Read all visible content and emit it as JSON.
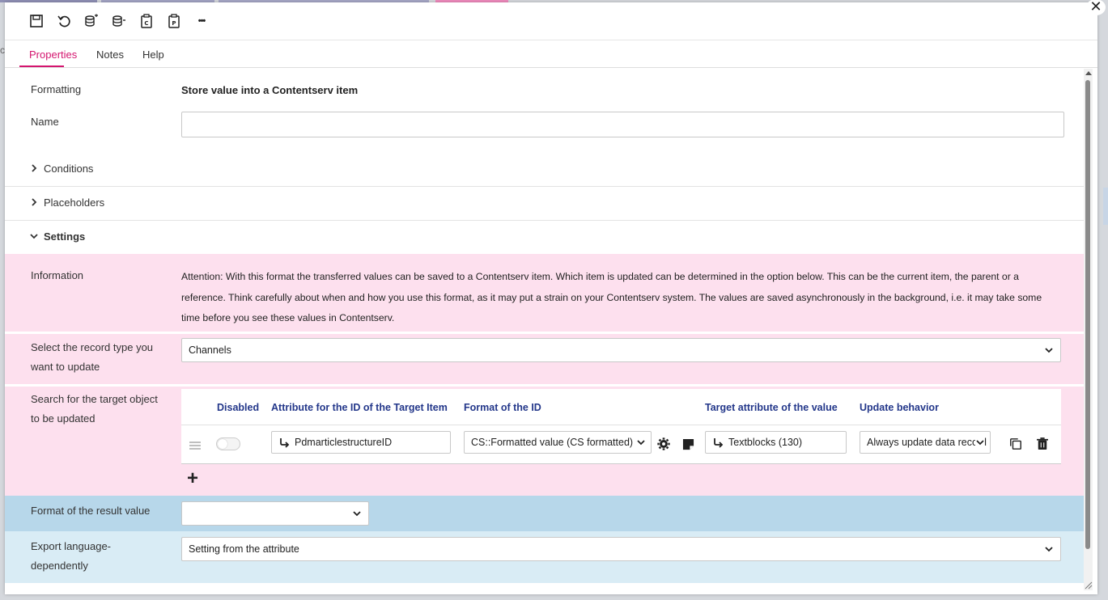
{
  "background": {
    "left_cut_text": "c",
    "tab_colors": [
      "#8f90b5",
      "#a3a4c4",
      "#a6a7c6",
      "#f08abd"
    ]
  },
  "dialog": {
    "close_symbol": "✕"
  },
  "toolbar": {
    "icons": [
      "save-icon",
      "undo-icon",
      "database-export-icon",
      "database-import-icon",
      "clipboard-copy-icon",
      "clipboard-paste-icon",
      "more-icon"
    ],
    "more_label": "•••"
  },
  "tabs": {
    "properties": "Properties",
    "notes": "Notes",
    "help": "Help"
  },
  "form": {
    "formatting_label": "Formatting",
    "formatting_value": "Store value into a Contentserv item",
    "name_label": "Name",
    "name_value": ""
  },
  "sections": {
    "conditions": "Conditions",
    "placeholders": "Placeholders",
    "settings": "Settings"
  },
  "settings": {
    "information_label": "Information",
    "information_text": "Attention: With this format the transferred values can be saved to a Contentserv item. Which item is updated can be determined in the option below. This can be the current item, the parent or a reference. Think carefully about when and how you use this format, as it may put a strain on your Contentserv system. The values are saved asynchronously in the background, i.e. it may take some time before you see these values in Contentserv.",
    "record_type_label": "Select the record type you want to update",
    "record_type_value": "Channels",
    "search_label": "Search for the target object to be updated",
    "grid": {
      "headers": {
        "disabled": "Disabled",
        "attribute_id": "Attribute for the ID of the Target Item",
        "format_id": "Format of the ID",
        "target_attr": "Target attribute of the value",
        "update_behavior": "Update behavior"
      },
      "row": {
        "disabled": false,
        "attribute_id": "PdmarticlestructureID",
        "format_id": "CS::Formatted value (CS formatted)",
        "target_attr": "Textblocks (130)",
        "update_behavior": "Always update data record"
      }
    },
    "add_symbol": "+",
    "result_format_label": "Format of the result value",
    "result_format_value": "",
    "export_language_label": "Export language-dependently",
    "export_language_value": "Setting from the attribute"
  },
  "colors": {
    "accent": "#d4156f",
    "pink_band": "#fde0ee",
    "blue_band": "#b7d7ea",
    "light_blue_band": "#d9ecf5",
    "header_text": "#23378a"
  }
}
